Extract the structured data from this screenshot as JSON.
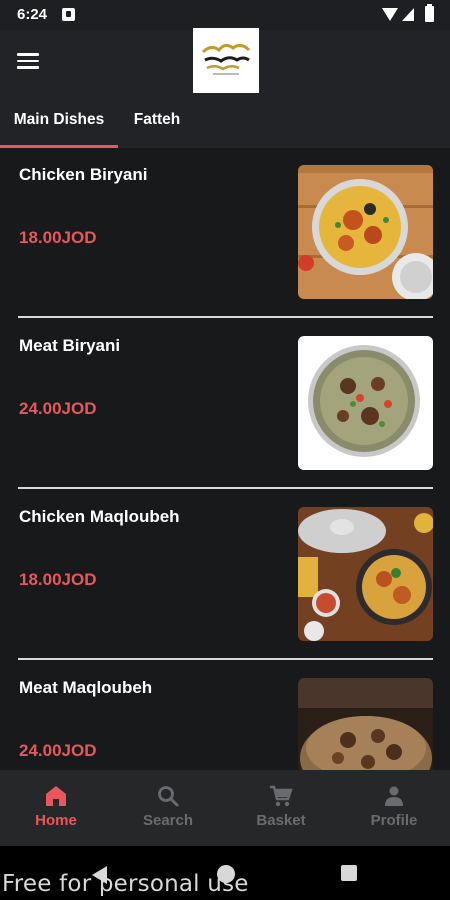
{
  "status_bar": {
    "time": "6:24"
  },
  "app_bar": {
    "logo_alt": "restaurant-logo"
  },
  "tabs": [
    {
      "label": "Main Dishes",
      "active": true
    },
    {
      "label": "Fatteh",
      "active": false
    }
  ],
  "items": [
    {
      "name": "Chicken Biryani",
      "price": "18.00JOD",
      "image": "chicken-biryani-photo"
    },
    {
      "name": "Meat Biryani",
      "price": "24.00JOD",
      "image": "meat-biryani-photo"
    },
    {
      "name": "Chicken Maqloubeh",
      "price": "18.00JOD",
      "image": "chicken-maqloubeh-photo"
    },
    {
      "name": "Meat Maqloubeh",
      "price": "24.00JOD",
      "image": "meat-maqloubeh-photo"
    }
  ],
  "bottom_nav": [
    {
      "label": "Home",
      "icon": "home-icon",
      "active": true
    },
    {
      "label": "Search",
      "icon": "search-icon",
      "active": false
    },
    {
      "label": "Basket",
      "icon": "cart-icon",
      "active": false
    },
    {
      "label": "Profile",
      "icon": "person-icon",
      "active": false
    }
  ],
  "watermark": "Free for personal use",
  "colors": {
    "accent": "#e8575b",
    "background": "#222326",
    "list_background": "#18191b",
    "nav_inactive": "#6a6b6e"
  }
}
